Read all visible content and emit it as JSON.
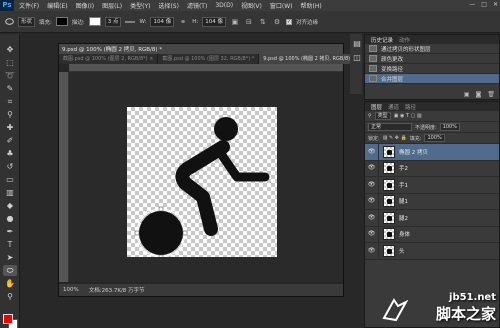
{
  "app": {
    "logo": "Ps"
  },
  "menubar": {
    "items": [
      "文件(F)",
      "编辑(E)",
      "图像(I)",
      "图层(L)",
      "类型(Y)",
      "选择(S)",
      "滤镜(T)",
      "3D(D)",
      "视图(V)",
      "窗口(W)",
      "帮助(H)"
    ],
    "window_controls": [
      "—",
      "□",
      "✕"
    ]
  },
  "options": {
    "shape_mode": "形状",
    "fill_label": "填充:",
    "stroke_label": "描边:",
    "stroke_width": "3 点",
    "w_label": "W:",
    "w_value": "104 像",
    "h_label": "H:",
    "h_value": "104 像",
    "align_edges_label": "对齐边缘",
    "fill_color": "#000000",
    "stroke_color": "#ffffff"
  },
  "document": {
    "title": "9.psd @ 100% (椭圆 2 拷贝, RGB/8) *",
    "tabs": [
      {
        "label": "截图.psd @ 100% (图层 2, RGB/8*) ×",
        "active": false
      },
      {
        "label": "截图.psd @ 100% (图层 32, RGB/8*) *",
        "active": false
      },
      {
        "label": "9.psd @ 100% (椭圆 2 拷贝, RGB/8) *",
        "active": true
      }
    ],
    "status_zoom": "100%",
    "status_doc": "文档:263.7K/8 万字节"
  },
  "history": {
    "tabs": [
      "历史记录",
      "动作"
    ],
    "items": [
      {
        "label": "通过拷贝的形状图层",
        "active": false
      },
      {
        "label": "颜色更改",
        "active": false
      },
      {
        "label": "变换路径",
        "active": false
      },
      {
        "label": "合并图层",
        "active": true
      }
    ]
  },
  "layers": {
    "tabs": [
      "图层",
      "通道",
      "路径"
    ],
    "kind_label": "类型",
    "blend_mode": "正常",
    "opacity_label": "不透明度:",
    "opacity_value": "100%",
    "lock_label": "锁定:",
    "fill_label": "填充:",
    "fill_value": "100%",
    "items": [
      {
        "name": "椭圆 2 拷贝",
        "selected": true
      },
      {
        "name": "手2",
        "selected": false
      },
      {
        "name": "手1",
        "selected": false
      },
      {
        "name": "腿1",
        "selected": false
      },
      {
        "name": "腿2",
        "selected": false
      },
      {
        "name": "身体",
        "selected": false
      },
      {
        "name": "头",
        "selected": false
      }
    ]
  },
  "watermark": {
    "url": "jb51.net",
    "text": "脚本之家"
  }
}
